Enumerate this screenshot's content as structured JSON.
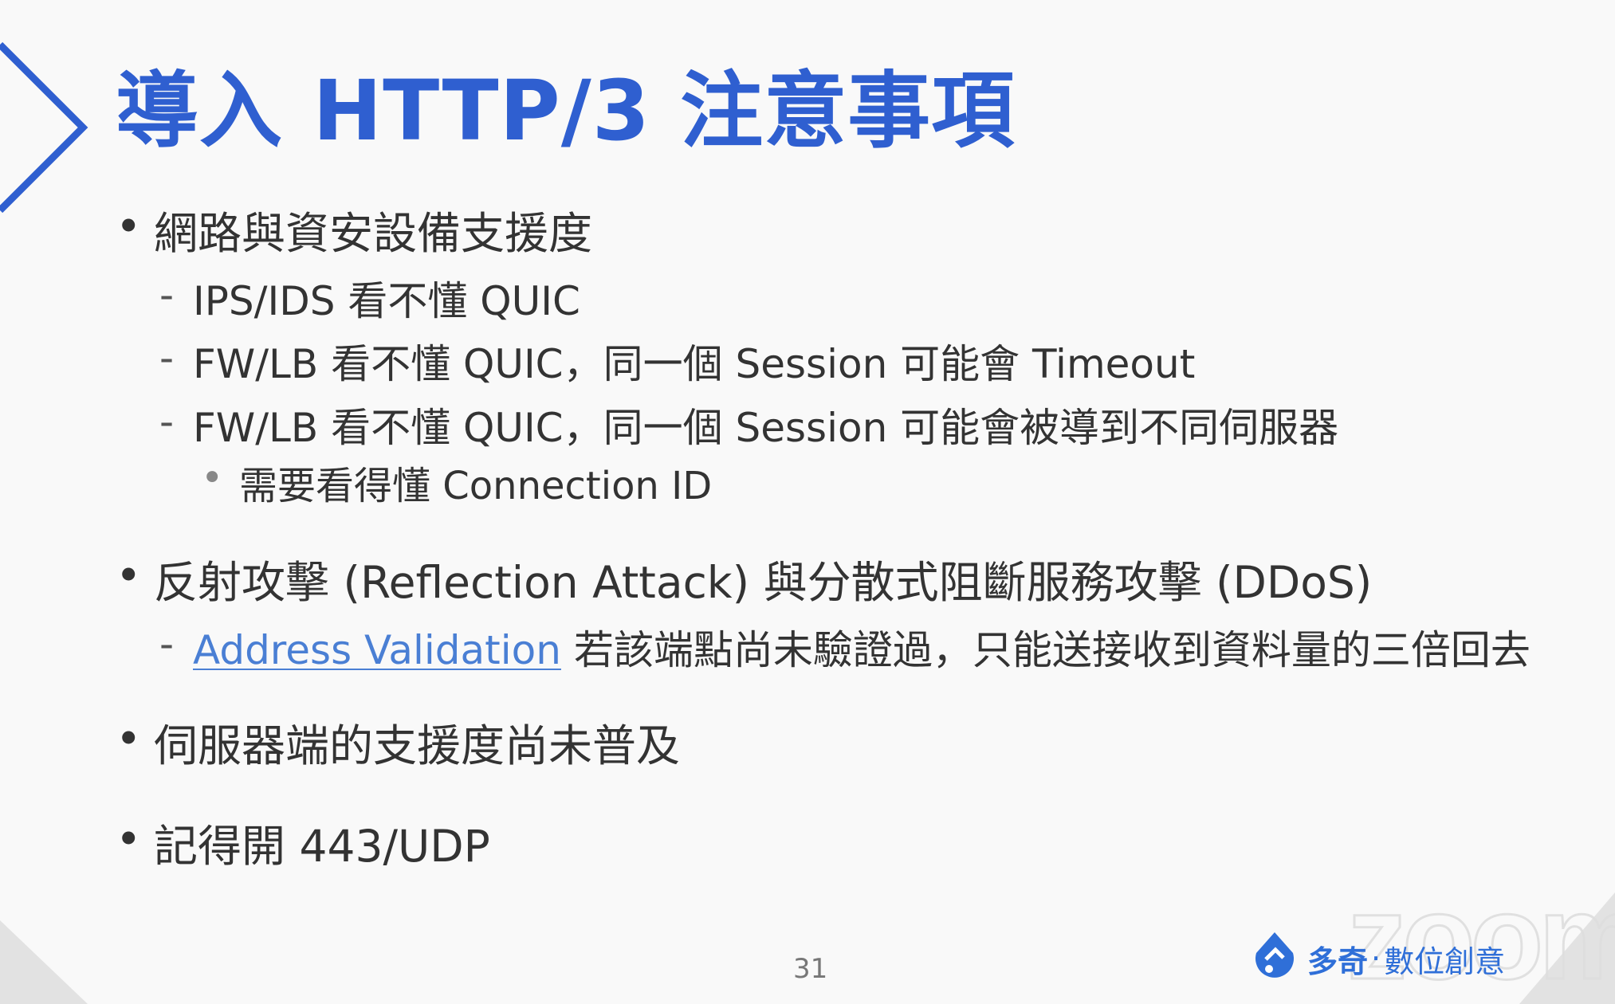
{
  "slide": {
    "title": "導入 HTTP/3 注意事項",
    "page_number": "31"
  },
  "bullets": {
    "b1": "網路與資安設備支援度",
    "b1_s1": "IPS/IDS 看不懂 QUIC",
    "b1_s2": "FW/LB 看不懂 QUIC，同一個 Session 可能會 Timeout",
    "b1_s3": "FW/LB 看不懂 QUIC，同一個 Session 可能會被導到不同伺服器",
    "b1_s3_sub": "需要看得懂 Connection ID",
    "b2": "反射攻擊 (Reflection Attack) 與分散式阻斷服務攻擊 (DDoS)",
    "b2_s1_link": "Address Validation",
    "b2_s1_text": " 若該端點尚未驗證過，只能送接收到資料量的三倍回去",
    "b3": "伺服器端的支援度尚未普及",
    "b4": "記得開 443/UDP"
  },
  "symbols": {
    "bullet": "•",
    "dash": "-",
    "sub_bullet": "•"
  },
  "branding": {
    "zoom_watermark": "zoom",
    "company_name": "多奇",
    "separator": "·",
    "company_sub": "數位創意"
  },
  "colors": {
    "title": "#2f5fd0",
    "text": "#333333",
    "link": "#4a7fd4",
    "brand": "#2f6fd8"
  }
}
